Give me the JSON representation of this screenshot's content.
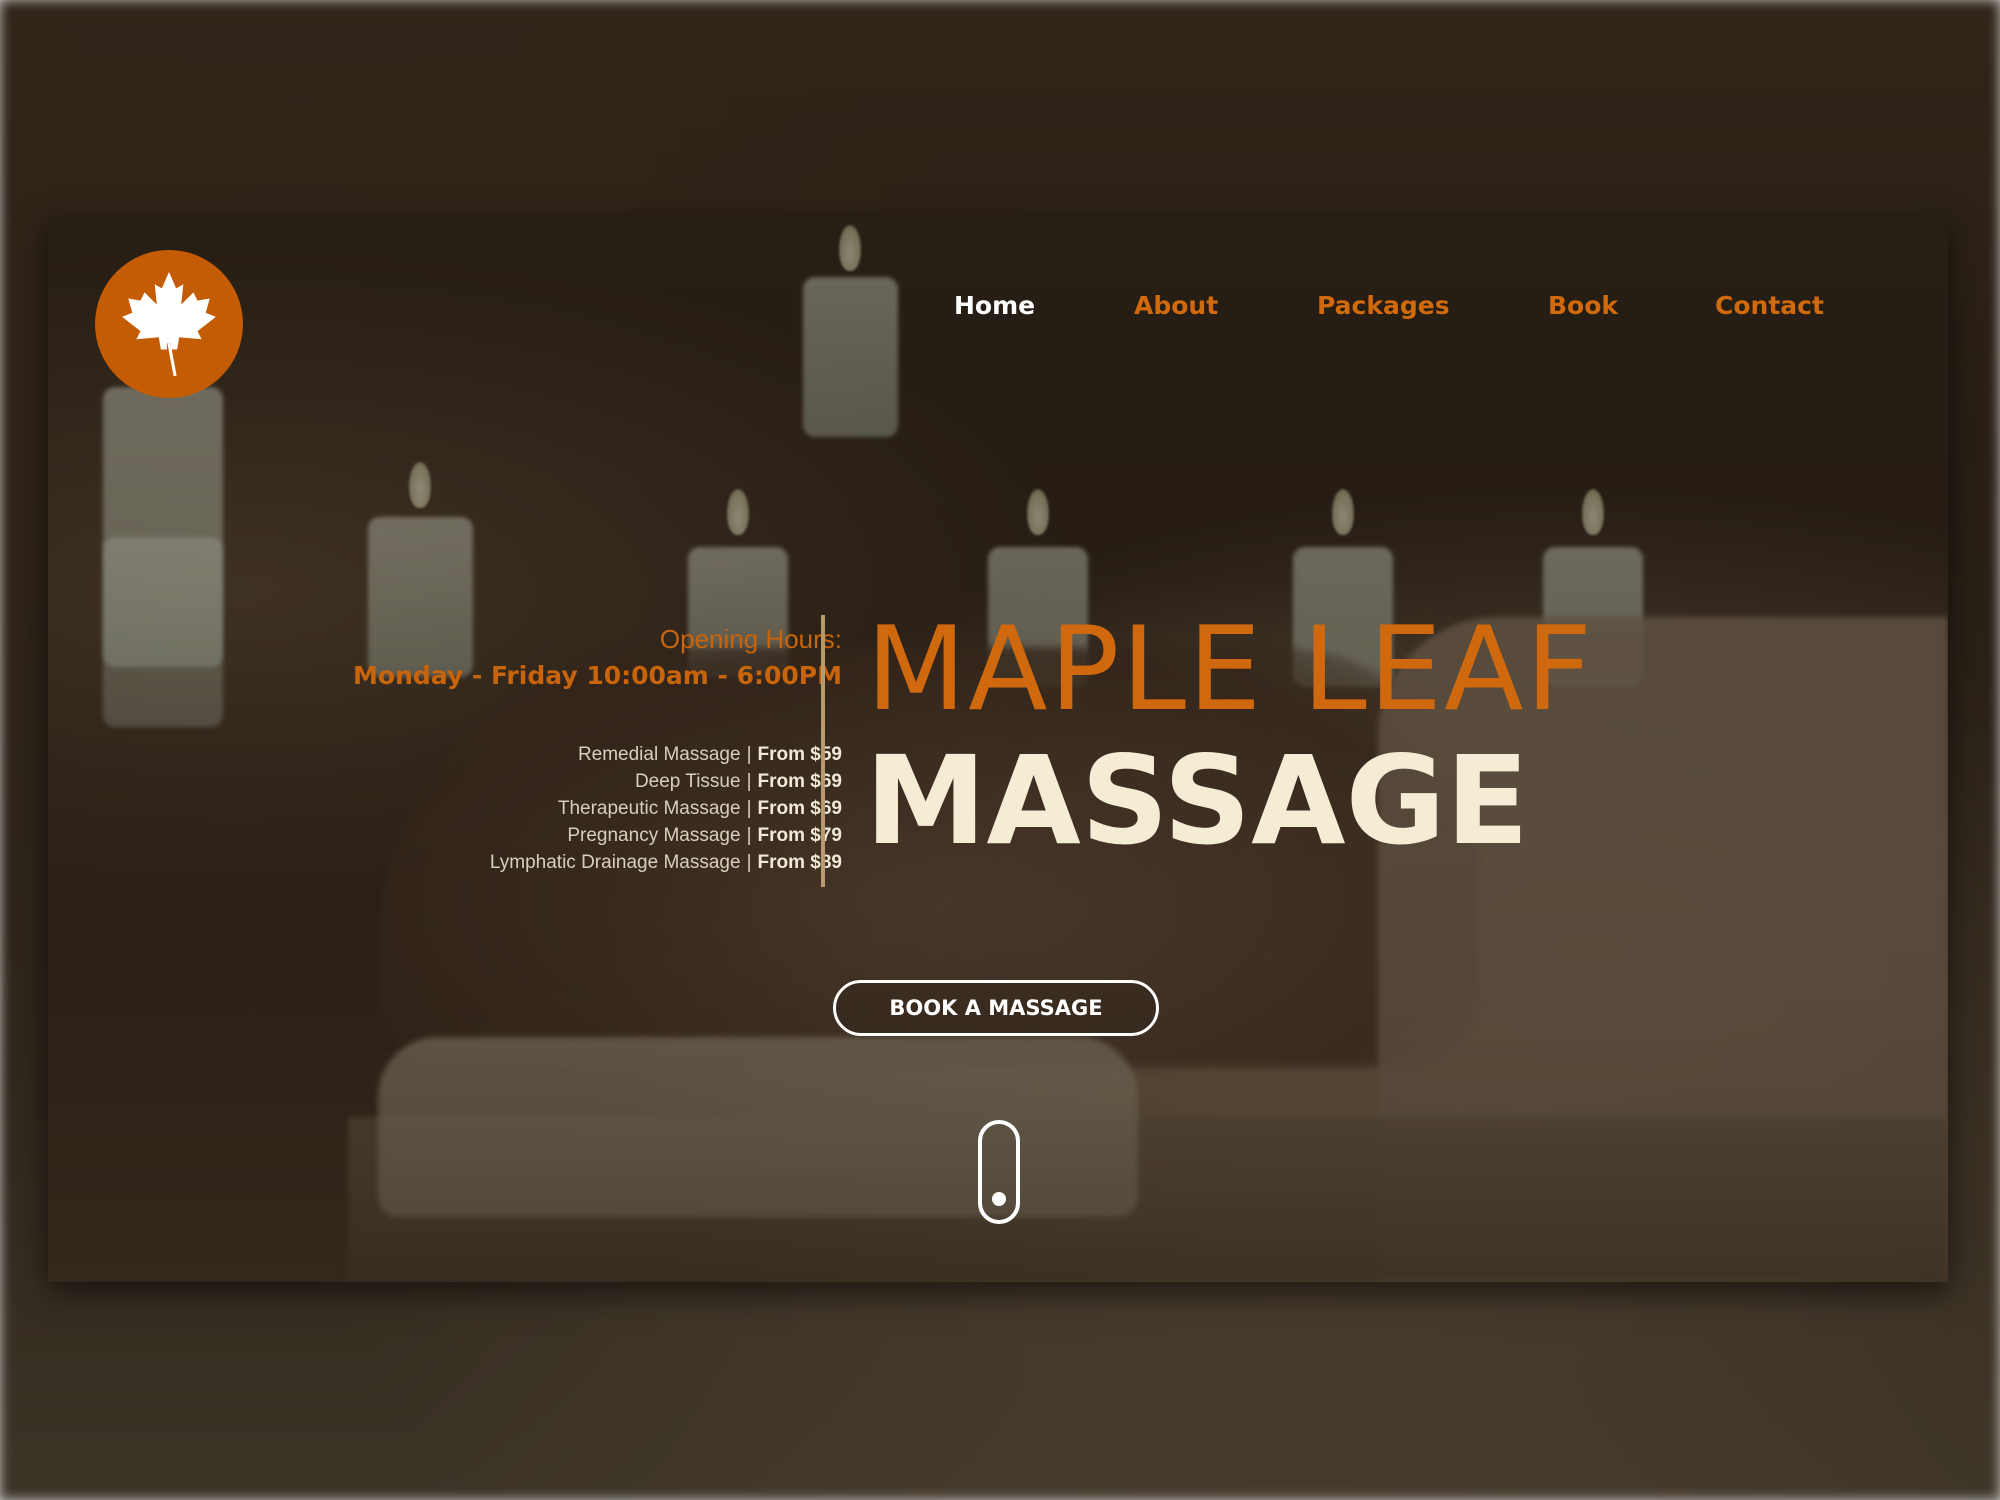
{
  "brand": {
    "logo_icon": "maple-leaf-icon",
    "logo_color": "#c45c05"
  },
  "nav": {
    "items": [
      {
        "label": "Home",
        "active": true
      },
      {
        "label": "About",
        "active": false
      },
      {
        "label": "Packages",
        "active": false
      },
      {
        "label": "Book",
        "active": false
      },
      {
        "label": "Contact",
        "active": false
      }
    ]
  },
  "hours": {
    "title": "Opening Hours:",
    "time": "Monday - Friday 10:00am - 6:00PM"
  },
  "services": [
    {
      "name": "Remedial Massage",
      "price": "From $59"
    },
    {
      "name": "Deep Tissue",
      "price": "From $69"
    },
    {
      "name": "Therapeutic Massage",
      "price": "From $69"
    },
    {
      "name": "Pregnancy Massage",
      "price": "From $79"
    },
    {
      "name": "Lymphatic Drainage Massage",
      "price": "From $89"
    }
  ],
  "separator": "|",
  "hero": {
    "title_top": "MAPLE LEAF",
    "title_bottom": "MASSAGE",
    "cta_label": "BOOK A MASSAGE"
  },
  "colors": {
    "accent": "#d0680e",
    "cream": "#f4ecd4",
    "nav_active": "#ffffff"
  },
  "icons": {
    "scroll": "scroll-mouse-icon"
  }
}
